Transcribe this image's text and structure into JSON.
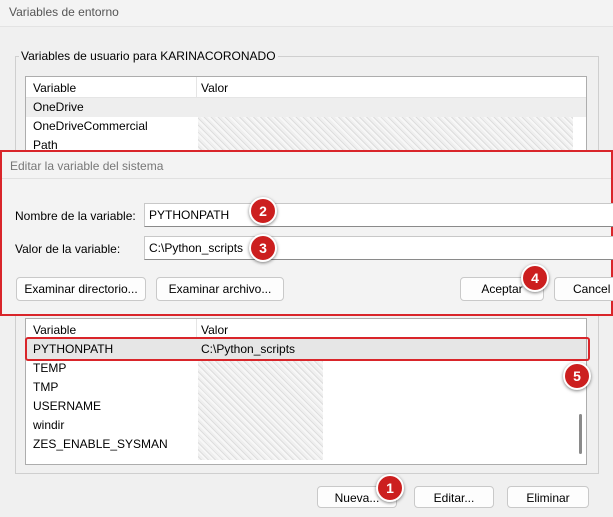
{
  "window": {
    "title": "Variables de entorno"
  },
  "user_vars": {
    "group_label": "Variables de usuario para KARINACORONADO",
    "columns": [
      "Variable",
      "Valor"
    ],
    "rows": [
      "OneDrive",
      "OneDriveCommercial",
      "Path"
    ]
  },
  "dialog": {
    "title": "Editar la variable del sistema",
    "name_label": "Nombre de la variable:",
    "name_value": "PYTHONPATH",
    "value_label": "Valor de la variable:",
    "value_value": "C:\\Python_scripts",
    "browse_dir": "Examinar directorio...",
    "browse_file": "Examinar archivo...",
    "accept": "Aceptar",
    "cancel": "Cancel"
  },
  "system_vars": {
    "columns": [
      "Variable",
      "Valor"
    ],
    "selected": {
      "name": "PYTHONPATH",
      "value": "C:\\Python_scripts"
    },
    "rows": [
      "TEMP",
      "TMP",
      "USERNAME",
      "windir",
      "ZES_ENABLE_SYSMAN"
    ]
  },
  "buttons": {
    "new": "Nueva...",
    "edit": "Editar...",
    "delete": "Eliminar"
  },
  "badges": [
    "1",
    "2",
    "3",
    "4",
    "5"
  ],
  "colors": {
    "annotation_red": "#d9252a",
    "badge_red": "#cc1f1f"
  }
}
